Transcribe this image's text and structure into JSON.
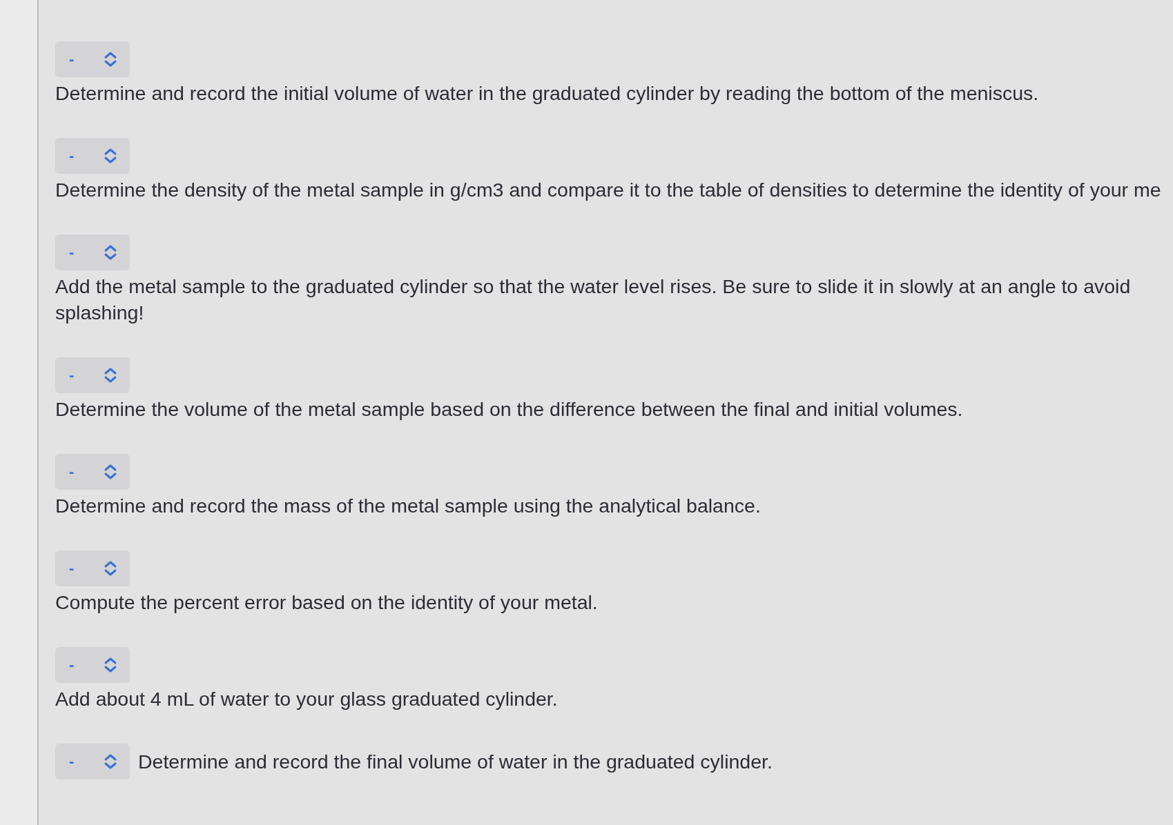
{
  "steps": [
    {
      "kind": "stacked",
      "selected_value": "-",
      "text": "Determine and record the initial volume of water in the graduated cylinder by reading the bottom of the meniscus."
    },
    {
      "kind": "stacked",
      "selected_value": "-",
      "text": "Determine the density of the metal sample in g/cm3 and compare it to the table of densities to determine the identity of your me"
    },
    {
      "kind": "stacked",
      "selected_value": "-",
      "text": "Add the metal sample to the graduated cylinder so that the water level rises. Be sure to slide it in slowly at an angle to avoid splashing!"
    },
    {
      "kind": "stacked",
      "selected_value": "-",
      "text": "Determine the volume of the metal sample based on the difference between the final and initial volumes."
    },
    {
      "kind": "stacked",
      "selected_value": "-",
      "text": "Determine and record the mass of the metal sample using the analytical balance."
    },
    {
      "kind": "stacked",
      "selected_value": "-",
      "text": "Compute the percent error based on the identity of your metal."
    },
    {
      "kind": "stacked",
      "selected_value": "-",
      "text": "Add about 4 mL of water to your glass graduated cylinder."
    },
    {
      "kind": "inline",
      "selected_value": "-",
      "text": "Determine and record the final volume of water in the graduated cylinder."
    }
  ]
}
